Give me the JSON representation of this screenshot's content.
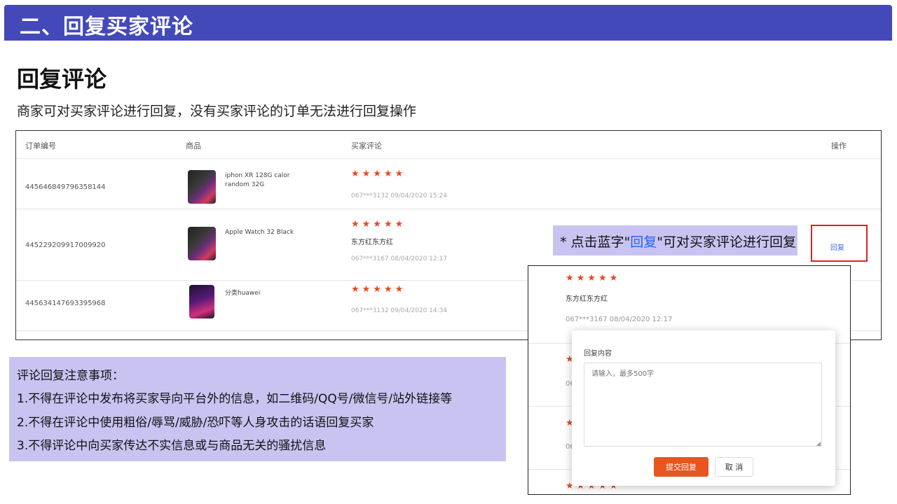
{
  "banner": {
    "title": "二、回复买家评论",
    "color": "#4349b8"
  },
  "section": {
    "title": "回复评论",
    "description": "商家可对买家评论进行回复，没有买家评论的订单无法进行回复操作"
  },
  "table": {
    "headers": {
      "order_no": "订单编号",
      "product": "商品",
      "review": "买家评论",
      "action": "操作"
    },
    "rows": [
      {
        "order_no": "445646849796358144",
        "product_name": "iphon XR 128G calor random 32G",
        "stars": "★★★★★",
        "review_text": "",
        "meta": "067***3132 09/04/2020 15:24"
      },
      {
        "order_no": "445229209917009920",
        "product_name": "Apple Watch 32 Black",
        "stars": "★★★★★",
        "review_text": "东方红东方红",
        "meta": "067***3167 08/04/2020 12:17",
        "action_label": "回复"
      },
      {
        "order_no": "445634147693395968",
        "product_name": "分类huawei",
        "stars": "★★★★★",
        "review_text": "",
        "meta": "067***3132 09/04/2020 14:34"
      }
    ]
  },
  "callout": {
    "before": "* 点击蓝字\"",
    "link": "回复",
    "after": "\"可对买家评论进行回复"
  },
  "notes": {
    "title": "评论回复注意事项：",
    "items": [
      "1.不得在评论中发布将买家导向平台外的信息，如二维码/QQ号/微信号/站外链接等",
      "2.不得在评论中使用粗俗/辱骂/威胁/恐吓等人身攻击的话语回复买家",
      "3.不得评论中向买家传达不实信息或与商品无关的骚扰信息"
    ]
  },
  "popup": {
    "stars": "★★★★★",
    "review_text": "东方红东方红",
    "meta": "067***3167 08/04/2020 12:17",
    "frag_star": "★",
    "frag_06": "06",
    "dialog": {
      "label": "回复内容",
      "placeholder": "请输入，最多500字",
      "submit": "提交回复",
      "cancel": "取 消"
    }
  },
  "colors": {
    "star": "#e8471e",
    "submit": "#e8551e",
    "link": "#3d6cf0",
    "highlight": "#e02020",
    "panel": "#c9c3f2"
  }
}
